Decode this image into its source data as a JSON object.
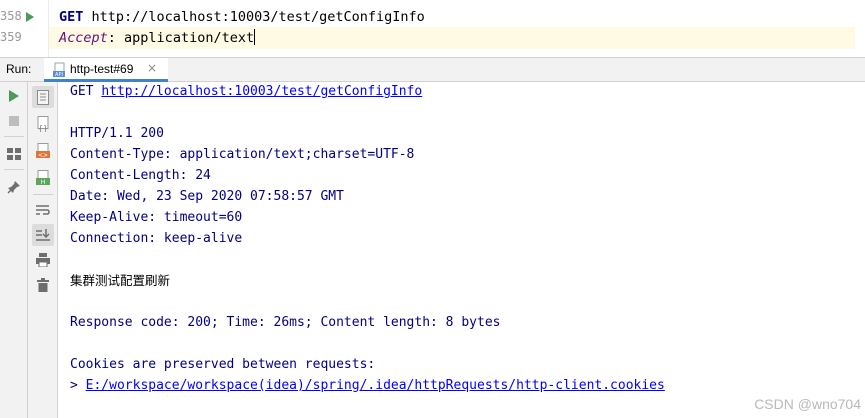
{
  "editor": {
    "lines": [
      {
        "number": "358",
        "method": "GET",
        "url": "http://localhost:10003/test/getConfigInfo"
      },
      {
        "number": "359",
        "header_name": "Accept",
        "header_sep": ": ",
        "header_value": "application/text"
      }
    ]
  },
  "run_panel": {
    "label": "Run:",
    "tab": {
      "icon": "api-file-icon",
      "label": "http-test#69",
      "close": "×"
    }
  },
  "console": {
    "request": {
      "method": "GET",
      "url": "http://localhost:10003/test/getConfigInfo"
    },
    "status_line": "HTTP/1.1 200",
    "headers": [
      "Content-Type: application/text;charset=UTF-8",
      "Content-Length: 24",
      "Date: Wed, 23 Sep 2020 07:58:57 GMT",
      "Keep-Alive: timeout=60",
      "Connection: keep-alive"
    ],
    "body": "集群测试配置刷新",
    "summary": "Response code: 200; Time: 26ms; Content length: 8 bytes",
    "cookies_note": "Cookies are preserved between requests:",
    "cookies_prefix": "> ",
    "cookies_path": "E:/workspace/workspace(idea)/spring/.idea/httpRequests/http-client.cookies"
  },
  "watermark": "CSDN @wno704",
  "colors": {
    "run_green": "#499c54",
    "link_blue": "#0000ff",
    "console_text": "#000080",
    "tab_underline": "#4083c9"
  }
}
